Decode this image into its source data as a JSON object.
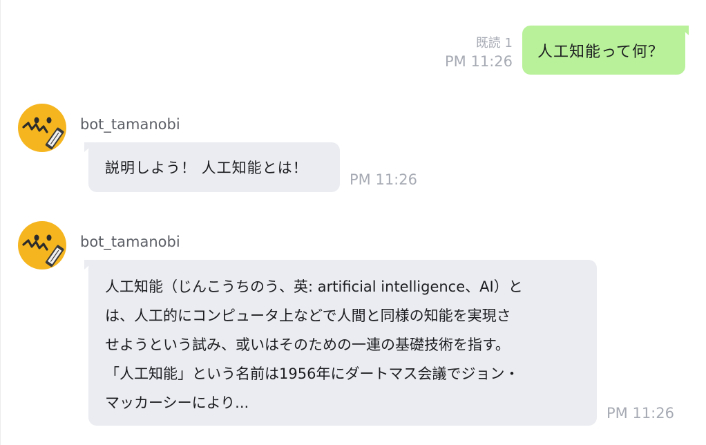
{
  "colors": {
    "outgoing_bubble": "#b9f19a",
    "incoming_bubble": "#eaecf1",
    "timestamp": "#a6aab3",
    "avatar": "#f5b51f"
  },
  "messages": [
    {
      "direction": "outgoing",
      "text": "人工知能って何？",
      "read_label": "既読 1",
      "time": "PM 11:26"
    },
    {
      "direction": "incoming",
      "sender": "bot_tamanobi",
      "avatar_icon": "worried-face-icon",
      "text": "説明しよう！ 人工知能とは！",
      "time": "PM 11:26"
    },
    {
      "direction": "incoming",
      "sender": "bot_tamanobi",
      "avatar_icon": "worried-face-icon",
      "lines": [
        "人工知能（じんこうちのう、英: artificial intelligence、AI）と",
        "は、人工的にコンピュータ上などで人間と同様の知能を実現さ",
        "せようという試み、或いはそのための一連の基礎技術を指す。",
        "「人工知能」という名前は1956年にダートマス会議でジョン・",
        "マッカーシーにより..."
      ],
      "time": "PM 11:26"
    }
  ]
}
